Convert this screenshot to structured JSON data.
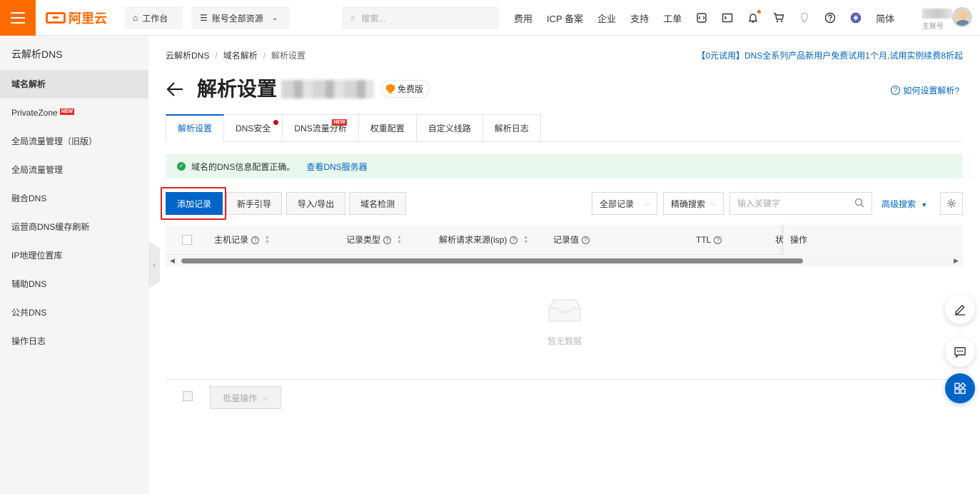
{
  "topbar": {
    "logo": "阿里云",
    "workbench": "工作台",
    "resources": "账号全部资源",
    "search_placeholder": "搜索...",
    "links": [
      "费用",
      "ICP 备案",
      "企业",
      "支持",
      "工单"
    ],
    "language": "简体",
    "user_role": "主账号",
    "accent_color": "#ff6a00"
  },
  "sidebar": {
    "title": "云解析DNS",
    "items": [
      {
        "label": "域名解析"
      },
      {
        "label": "PrivateZone",
        "badge": "NEW"
      },
      {
        "label": "全局流量管理（旧版）"
      },
      {
        "label": "全局流量管理"
      },
      {
        "label": "融合DNS"
      },
      {
        "label": "运营商DNS缓存刷新"
      },
      {
        "label": "IP地理位置库"
      },
      {
        "label": "辅助DNS"
      },
      {
        "label": "公共DNS"
      },
      {
        "label": "操作日志"
      }
    ]
  },
  "breadcrumb": [
    "云解析DNS",
    "域名解析",
    "解析设置"
  ],
  "promo": "【0元试用】DNS全系列产品新用户免费试用1个月,试用实例续费8折起",
  "page": {
    "title": "解析设置",
    "edition": "免费版",
    "help": "如何设置解析?"
  },
  "tabs": [
    {
      "label": "解析设置"
    },
    {
      "label": "DNS安全"
    },
    {
      "label": "DNS流量分析",
      "badge": "NEW"
    },
    {
      "label": "权重配置"
    },
    {
      "label": "自定义线路"
    },
    {
      "label": "解析日志"
    }
  ],
  "alert": {
    "text": "域名的DNS信息配置正确。",
    "link": "查看DNS服务器"
  },
  "toolbar": {
    "add_record": "添加记录",
    "guide": "新手引导",
    "import_export": "导入/导出",
    "domain_check": "域名检测",
    "record_filter": "全部记录",
    "search_mode": "精确搜索",
    "keyword_placeholder": "输入关键字",
    "advanced_search": "高级搜索"
  },
  "table": {
    "columns": {
      "host": "主机记录",
      "type": "记录类型",
      "isp": "解析请求来源(isp)",
      "value": "记录值",
      "ttl": "TTL",
      "status": "状",
      "actions": "操作"
    },
    "empty_text": "暂无数据"
  },
  "footer": {
    "batch": "批量操作"
  },
  "colors": {
    "primary": "#0064c8",
    "success": "#23a455",
    "highlight": "#e02020"
  }
}
